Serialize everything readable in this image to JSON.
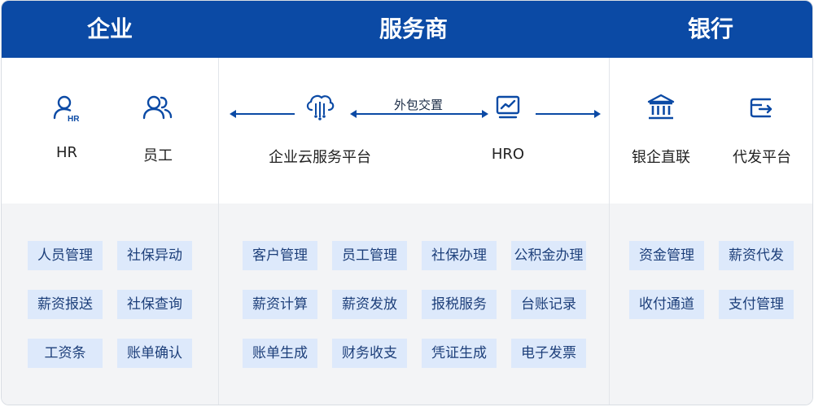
{
  "header": {
    "enterprise": "企业",
    "provider": "服务商",
    "bank": "银行"
  },
  "enterprise": {
    "nodes": [
      {
        "label": "HR",
        "icon": "hr-user-icon"
      },
      {
        "label": "员工",
        "icon": "users-icon"
      }
    ],
    "functions": [
      "人员管理",
      "社保异动",
      "薪资报送",
      "社保查询",
      "工资条",
      "账单确认"
    ]
  },
  "provider": {
    "nodes": [
      {
        "label": "企业云服务平台",
        "icon": "cloud-chip-icon"
      },
      {
        "label": "HRO",
        "icon": "monitor-chart-icon"
      }
    ],
    "outsourcing_label": "外包交置",
    "functions": [
      "客户管理",
      "员工管理",
      "社保办理",
      "公积金办理",
      "薪资计算",
      "薪资发放",
      "报税服务",
      "台账记录",
      "账单生成",
      "财务收支",
      "凭证生成",
      "电子发票"
    ]
  },
  "bank": {
    "nodes": [
      {
        "label": "银企直联",
        "icon": "bank-icon"
      },
      {
        "label": "代发平台",
        "icon": "wallet-transfer-icon"
      }
    ],
    "functions": [
      "资金管理",
      "薪资代发",
      "收付通道",
      "支付管理"
    ]
  },
  "colors": {
    "primary": "#0b4aa5",
    "chip_bg": "#dde9fb",
    "lower_bg": "#f3f4f6"
  }
}
